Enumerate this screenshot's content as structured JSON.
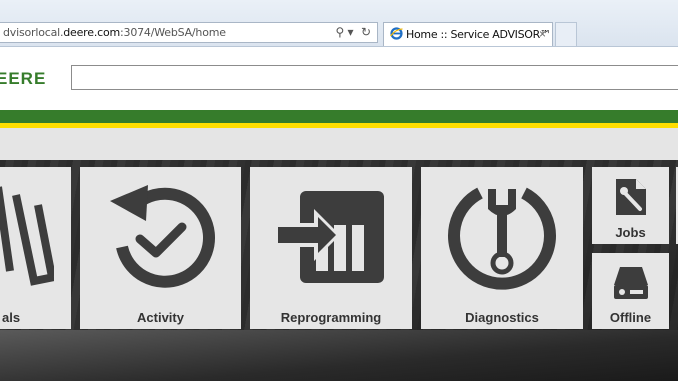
{
  "browser": {
    "url_prefix": "dvisorlocal.",
    "url_domain": "deere.com",
    "url_suffix": ":3074/WebSA/home",
    "tab_title": "Home :: Service ADVISOR™",
    "tab_close": "×",
    "search_glyph": "⚲ ▾",
    "refresh_glyph": "↻"
  },
  "header": {
    "logo_text": "EERE",
    "search_value": ""
  },
  "tiles": {
    "manuals": "als",
    "activity": "Activity",
    "reprogramming": "Reprogramming",
    "diagnostics": "Diagnostics",
    "jobs": "Jobs",
    "offline": "Offline"
  },
  "colors": {
    "brand_green": "#367c2b",
    "brand_yellow": "#ffde00",
    "tile_bg": "#e6e6e6",
    "icon_dark": "#3d3d3d"
  }
}
